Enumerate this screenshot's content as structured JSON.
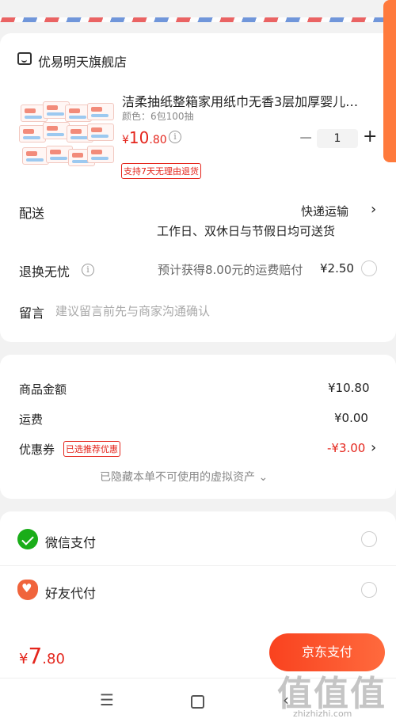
{
  "shop": {
    "name": "优易明天旗舰店",
    "icon": "shop-icon"
  },
  "product": {
    "title": "洁柔抽纸整箱家用纸巾无香3层加厚婴儿…",
    "spec": "颜色：6包100抽",
    "price_symbol": "¥",
    "price_int": "10",
    "price_dec": ".80",
    "quantity": "1",
    "minus_label": "−",
    "plus_label": "+",
    "return_tag": "支持7天无理由退货"
  },
  "delivery": {
    "label": "配送",
    "method": "快递运输",
    "note": "工作日、双休日与节假日均可送货"
  },
  "returns": {
    "label": "退换无忧",
    "note": "预计获得8.00元的运费赔付",
    "price": "¥2.50"
  },
  "message": {
    "label": "留言",
    "placeholder": "建议留言前先与商家沟通确认"
  },
  "summary": {
    "goods_label": "商品金额",
    "goods_value": "¥10.80",
    "shipping_label": "运费",
    "shipping_value": "¥0.00",
    "coupon_label": "优惠券",
    "coupon_tag": "已选推荐优惠",
    "coupon_value": "-¥3.00",
    "hidden_note": "已隐藏本单不可使用的虚拟资产 ⌄"
  },
  "payment_methods": [
    {
      "label": "微信支付",
      "icon": "wechat-pay-icon"
    },
    {
      "label": "好友代付",
      "icon": "friend-pay-icon"
    }
  ],
  "footer": {
    "total_symbol": "¥",
    "total_int": "7",
    "total_dec": ".80",
    "pay_button": "京东支付"
  },
  "watermark": {
    "text": "值值值",
    "url": "zhizhizhi.com"
  },
  "colors": {
    "accent": "#e4251c",
    "button": "#f9421f",
    "wechat": "#1aad19"
  }
}
